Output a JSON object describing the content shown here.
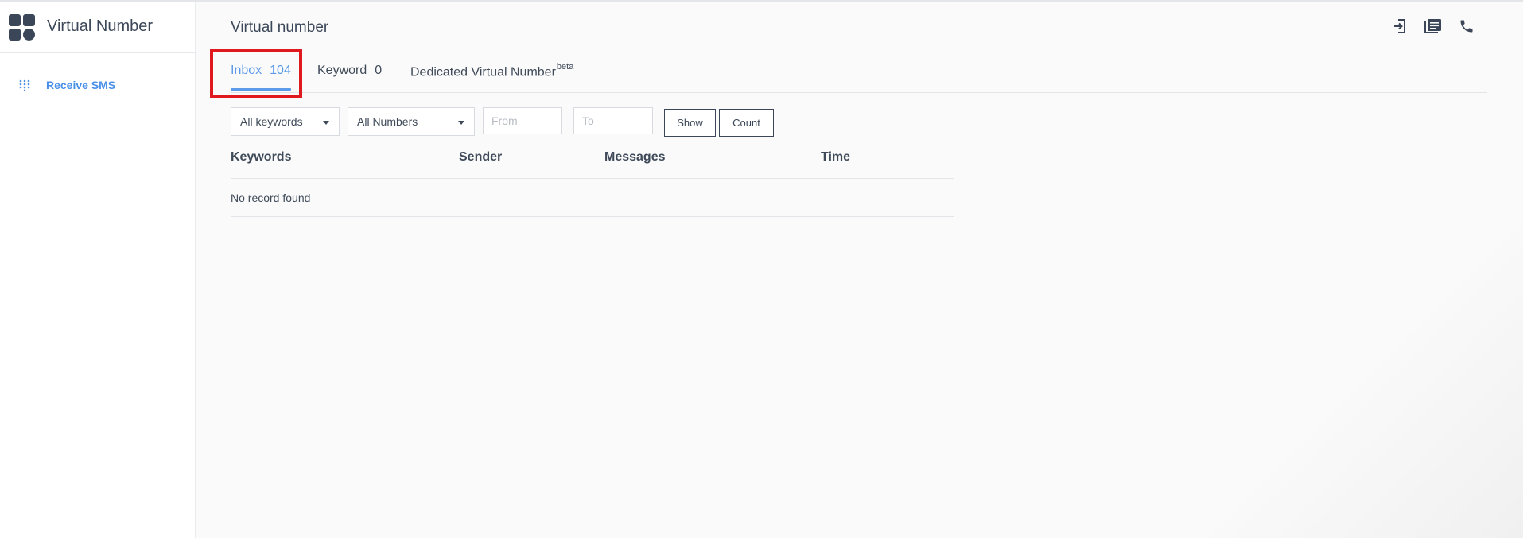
{
  "sidebar": {
    "app_title": "Virtual Number",
    "items": [
      {
        "label": "Receive SMS",
        "icon": "dial-pad-icon"
      }
    ]
  },
  "main": {
    "title": "Virtual number",
    "header_icons": [
      "login-icon",
      "message-list-icon",
      "phone-icon"
    ],
    "tabs": [
      {
        "label": "Inbox",
        "count": "104",
        "active": true
      },
      {
        "label": "Keyword",
        "count": "0",
        "active": false
      },
      {
        "label": "Dedicated Virtual Number",
        "sup": "beta",
        "active": false
      }
    ],
    "filters": {
      "keywords_select": "All keywords",
      "numbers_select": "All Numbers",
      "from_placeholder": "From",
      "to_placeholder": "To",
      "show_button": "Show",
      "count_button": "Count"
    },
    "table": {
      "columns": [
        "Keywords",
        "Sender",
        "Messages",
        "Time"
      ],
      "empty_message": "No record found"
    }
  },
  "colors": {
    "accent": "#5b9be9",
    "highlight": "#e0191f",
    "text": "#3f4a59"
  }
}
